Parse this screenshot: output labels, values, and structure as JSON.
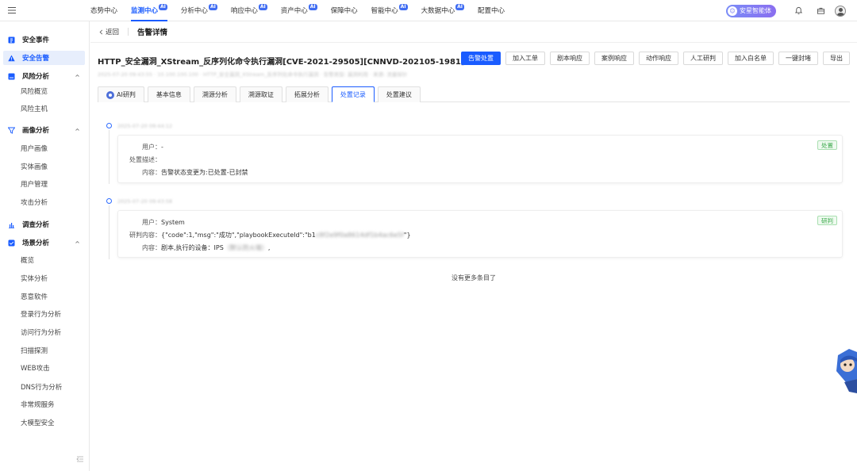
{
  "topnav": {
    "items": [
      {
        "label": "态势中心",
        "ai": false,
        "active": false
      },
      {
        "label": "监测中心",
        "ai": true,
        "active": true
      },
      {
        "label": "分析中心",
        "ai": true,
        "active": false
      },
      {
        "label": "响应中心",
        "ai": true,
        "active": false
      },
      {
        "label": "资产中心",
        "ai": true,
        "active": false
      },
      {
        "label": "保障中心",
        "ai": false,
        "active": false
      },
      {
        "label": "智能中心",
        "ai": true,
        "active": false
      },
      {
        "label": "大数据中心",
        "ai": true,
        "active": false
      },
      {
        "label": "配置中心",
        "ai": false,
        "active": false
      }
    ],
    "ai_badge": "AI",
    "assistant_label": "安星智能体",
    "accent_color": "#1a5cff"
  },
  "sidebar": {
    "items": [
      {
        "label": "安全事件",
        "type": "group",
        "icon": "event-icon"
      },
      {
        "label": "安全告警",
        "type": "group",
        "icon": "warning-icon",
        "active": true
      },
      {
        "label": "风险分析",
        "type": "group",
        "icon": "risk-icon",
        "expanded": true
      },
      {
        "label": "风险概览",
        "type": "sub"
      },
      {
        "label": "风险主机",
        "type": "sub"
      },
      {
        "label": "画像分析",
        "type": "group",
        "icon": "funnel-icon",
        "expanded": true
      },
      {
        "label": "用户画像",
        "type": "sub"
      },
      {
        "label": "实体画像",
        "type": "sub"
      },
      {
        "label": "用户管理",
        "type": "sub"
      },
      {
        "label": "攻击分析",
        "type": "sub"
      },
      {
        "label": "调查分析",
        "type": "group",
        "icon": "bar-chart-icon"
      },
      {
        "label": "场景分析",
        "type": "group",
        "icon": "scene-icon",
        "expanded": true
      },
      {
        "label": "概览",
        "type": "sub"
      },
      {
        "label": "实体分析",
        "type": "sub"
      },
      {
        "label": "恶意软件",
        "type": "sub"
      },
      {
        "label": "登录行为分析",
        "type": "sub"
      },
      {
        "label": "访问行为分析",
        "type": "sub"
      },
      {
        "label": "扫描探测",
        "type": "sub"
      },
      {
        "label": "WEB攻击",
        "type": "sub"
      },
      {
        "label": "DNS行为分析",
        "type": "sub"
      },
      {
        "label": "非常规服务",
        "type": "sub"
      },
      {
        "label": "大模型安全",
        "type": "sub"
      }
    ]
  },
  "header": {
    "back_label": "返回",
    "page_title": "告警详情"
  },
  "alert": {
    "title": "HTTP_安全漏洞_XStream_反序列化命令执行漏洞[CVE-2021-29505][CNNVD-202105-1981]",
    "subtitle": "2025-07-20 09:43:55 · 10.100.100.100 · HTTP_安全漏洞_XStream_反序列化命令执行漏洞 · 告警类型: 漏洞利用 · 来源: 流量探针"
  },
  "actions": [
    {
      "label": "告警处置",
      "primary": true
    },
    {
      "label": "加入工单",
      "primary": false
    },
    {
      "label": "剧本响应",
      "primary": false
    },
    {
      "label": "案例响应",
      "primary": false
    },
    {
      "label": "动作响应",
      "primary": false
    },
    {
      "label": "人工研判",
      "primary": false
    },
    {
      "label": "加入白名单",
      "primary": false
    },
    {
      "label": "一键封堵",
      "primary": false
    },
    {
      "label": "导出",
      "primary": false
    }
  ],
  "tabs": [
    {
      "label": "AI研判",
      "ai_icon": true,
      "active": false
    },
    {
      "label": "基本信息",
      "active": false
    },
    {
      "label": "溯源分析",
      "active": false
    },
    {
      "label": "溯源取证",
      "active": false
    },
    {
      "label": "拓展分析",
      "active": false
    },
    {
      "label": "处置记录",
      "active": true
    },
    {
      "label": "处置建议",
      "active": false
    }
  ],
  "records": [
    {
      "time": "2025-07-20 09:44:12",
      "tag": "处置",
      "rows": [
        {
          "label": "用户：",
          "value": "-"
        },
        {
          "label": "处置描述：",
          "value": ""
        },
        {
          "label": "内容：",
          "value": "告警状态变更为:已处置-已封禁"
        }
      ]
    },
    {
      "time": "2025-07-20 09:43:58",
      "tag": "研判",
      "rows": [
        {
          "label": "用户：",
          "value": "System"
        },
        {
          "label": "研判内容：",
          "value": "{\"code\":1,\"msg\":\"成功\",\"playbookExecuteId\":\"b1",
          "value_blur": "c8f2e9f0a8614df1b4ac6e5f",
          "value_tail": "\"}"
        },
        {
          "label": "内容：",
          "value": "剧本,执行的设备：IPS",
          "value_blur": "（默认防火墙）",
          "value_tail": ","
        }
      ]
    }
  ],
  "no_more": "没有更多条目了"
}
